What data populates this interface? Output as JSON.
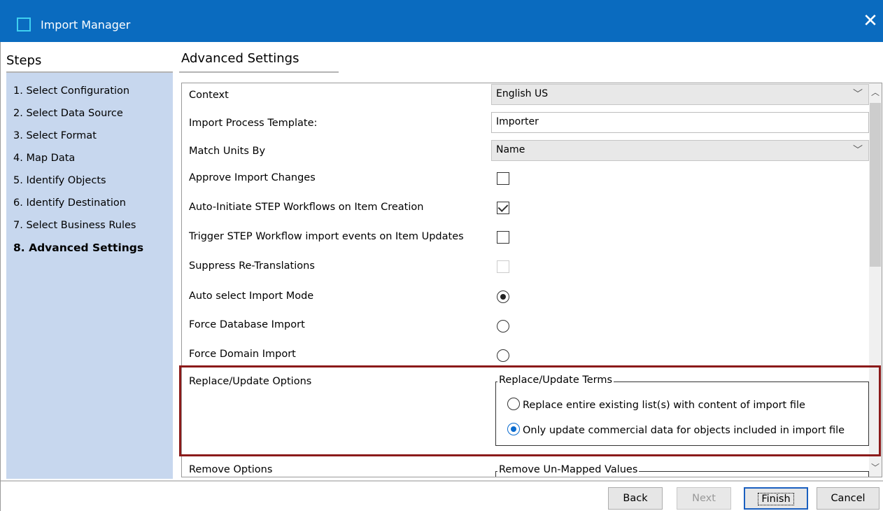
{
  "window": {
    "title": "Import Manager",
    "close_glyph": "✕"
  },
  "steps": {
    "heading": "Steps",
    "items": [
      {
        "label": "1. Select Configuration"
      },
      {
        "label": "2. Select Data Source"
      },
      {
        "label": "3. Select Format"
      },
      {
        "label": "4. Map Data"
      },
      {
        "label": "5. Identify Objects"
      },
      {
        "label": "6. Identify Destination"
      },
      {
        "label": "7. Select Business Rules"
      },
      {
        "label": "8. Advanced Settings",
        "active": true
      }
    ]
  },
  "main": {
    "heading": "Advanced Settings",
    "settings": {
      "context": {
        "label": "Context",
        "value": "English US"
      },
      "template": {
        "label": "Import Process Template:",
        "value": "Importer"
      },
      "match_units": {
        "label": "Match Units By",
        "value": "Name"
      },
      "approve": {
        "label": "Approve Import Changes",
        "checked": false
      },
      "auto_initiate": {
        "label": "Auto-Initiate STEP Workflows on Item Creation",
        "checked": true
      },
      "trigger": {
        "label": "Trigger STEP Workflow import events on Item Updates",
        "checked": false
      },
      "suppress": {
        "label": "Suppress Re-Translations",
        "checked": false,
        "disabled": true
      },
      "auto_select": {
        "label": "Auto select Import Mode",
        "selected": true
      },
      "force_db": {
        "label": "Force Database Import",
        "selected": false
      },
      "force_domain": {
        "label": "Force Domain Import",
        "selected": false
      },
      "replace_update": {
        "label": "Replace/Update Options",
        "group_title": "Replace/Update Terms",
        "options": [
          {
            "label": "Replace entire existing list(s) with content of import file",
            "selected": false
          },
          {
            "label": "Only update commercial data for objects included in import file",
            "selected": true
          }
        ]
      },
      "remove": {
        "label": "Remove Options",
        "group_title": "Remove Un-Mapped Values"
      }
    }
  },
  "footer": {
    "back": "Back",
    "next": "Next",
    "finish": "Finish",
    "cancel": "Cancel"
  },
  "colors": {
    "titlebar": "#0a6bbf",
    "steps_bg": "#c7d7ee",
    "highlight": "#8b1a1a"
  }
}
